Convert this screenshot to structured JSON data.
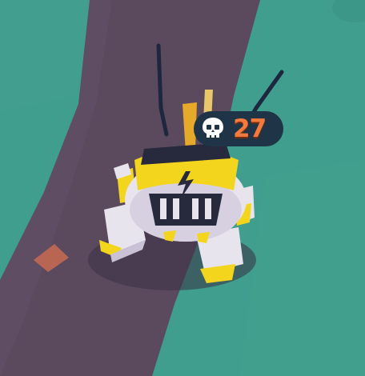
{
  "hud": {
    "kill_icon": "skull-icon",
    "kill_count": "27"
  },
  "colors": {
    "grass": "#3f9e8d",
    "path": "#5b4a5e",
    "badge_bg": "#1f3447",
    "count_text": "#f27a3d",
    "robot_yellow": "#f4d51e",
    "robot_white": "#e8e4ee",
    "robot_dark": "#262a3c"
  }
}
